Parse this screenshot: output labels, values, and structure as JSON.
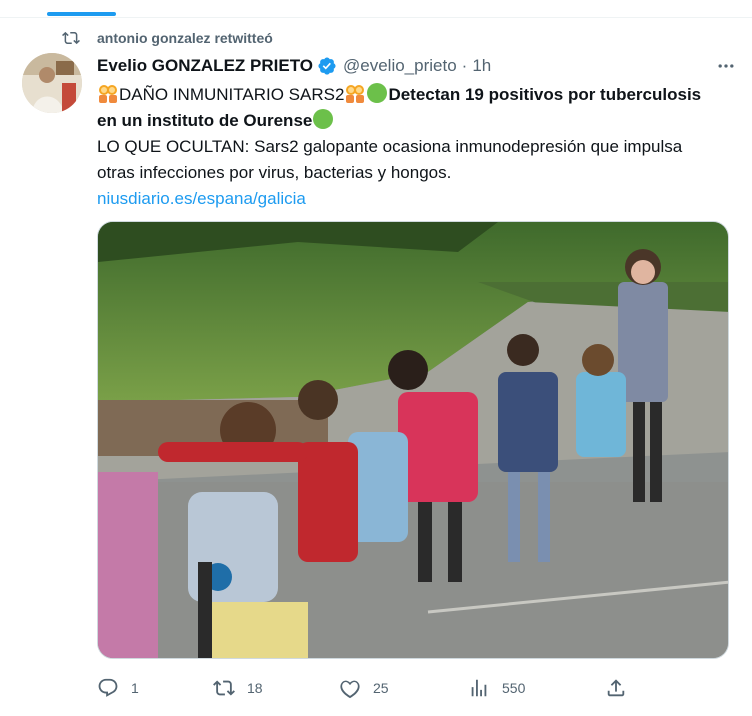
{
  "retweet": {
    "icon": "retweet-icon",
    "text": "antonio gonzalez retwitteó"
  },
  "author": {
    "name": "Evelio GONZALEZ PRIETO",
    "handle": "@evelio_prieto",
    "separator": "·",
    "time": "1h",
    "verified_icon": "verified-badge-icon"
  },
  "tweet": {
    "line1_text": "DAÑO INMUNITARIO SARS2",
    "line1_bold": "Detectan 19 positivos por tuberculosis en un instituto de Ourense",
    "line2": "LO QUE OCULTAN: Sars2 galopante ocasiona inmunodepresión que impulsa otras infecciones por virus, bacterias y hongos.",
    "link": "niusdiario.es/espana/galicia",
    "media_description": "photo of children walking in a line on a school playground with a masked teacher"
  },
  "actions": {
    "reply_count": "1",
    "retweet_count": "18",
    "like_count": "25",
    "views_count": "550"
  },
  "colors": {
    "accent": "#1d9bf0",
    "secondary_text": "#536471",
    "border": "#eff3f4",
    "green_dot": "#6cc04a"
  }
}
